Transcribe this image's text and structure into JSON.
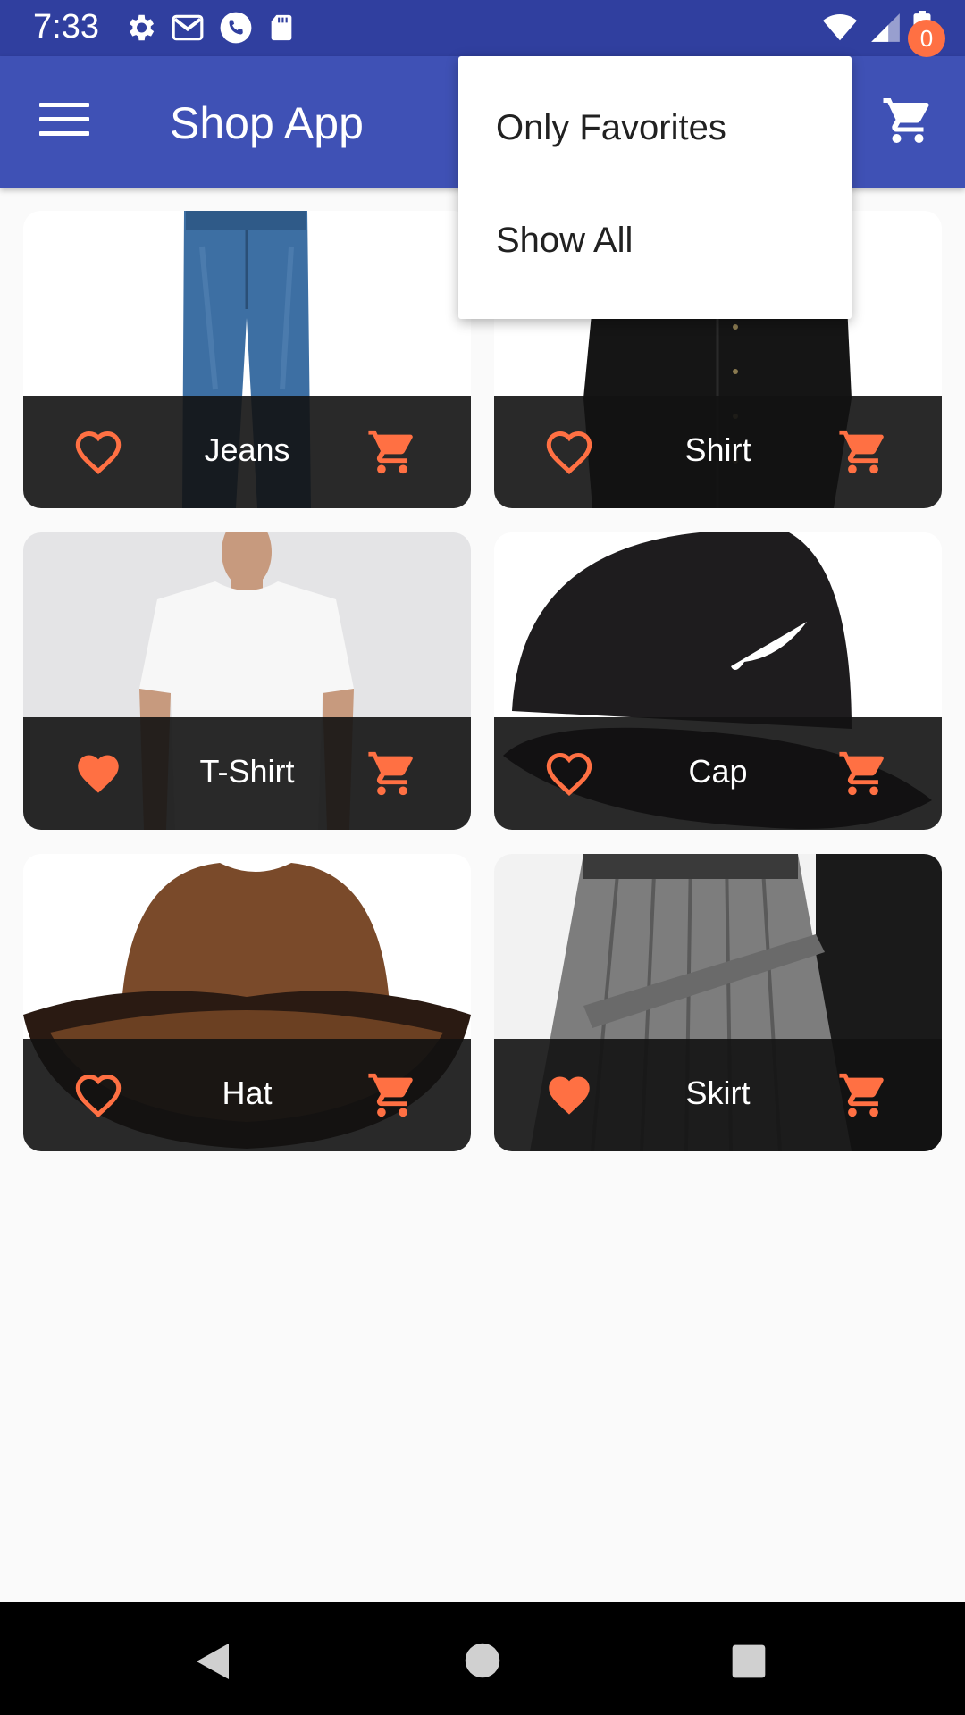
{
  "status_bar": {
    "time": "7:33",
    "left_icons": [
      "settings-icon",
      "gmail-icon",
      "phone-icon",
      "sd-card-icon"
    ],
    "right_icons": [
      "wifi-icon",
      "signal-icon",
      "battery-icon"
    ]
  },
  "app_bar": {
    "title": "Shop App",
    "cart_badge": "0"
  },
  "colors": {
    "accent": "#ff7043",
    "app_bar": "#3f51b5",
    "status_bar": "#303f9f"
  },
  "popup_menu": {
    "items": [
      "Only Favorites",
      "Show All"
    ]
  },
  "products": [
    {
      "title": "Jeans",
      "favorite": false
    },
    {
      "title": "Shirt",
      "favorite": false
    },
    {
      "title": "T-Shirt",
      "favorite": true
    },
    {
      "title": "Cap",
      "favorite": false
    },
    {
      "title": "Hat",
      "favorite": false
    },
    {
      "title": "Skirt",
      "favorite": true
    }
  ],
  "nav_bar": {
    "buttons": [
      "back-icon",
      "home-icon",
      "recents-icon"
    ]
  }
}
